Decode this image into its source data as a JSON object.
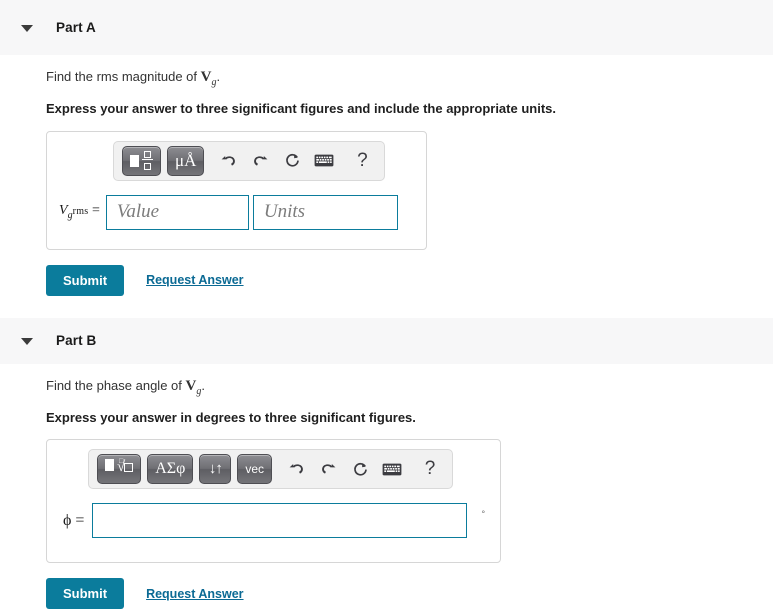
{
  "parts": [
    {
      "id": "part-a",
      "title": "Part A",
      "chevron_icon": "chevron-down-icon",
      "prompt_prefix": "Find the rms magnitude of ",
      "prompt_symbol": "V",
      "prompt_symbol_sub": "g",
      "prompt_suffix": ".",
      "instruction": "Express your answer to three significant figures and include the appropriate units.",
      "toolbar": [
        {
          "name": "template-button",
          "type": "template-squares",
          "label": ""
        },
        {
          "name": "units-button",
          "type": "text",
          "label": "μÅ"
        },
        {
          "name": "undo-icon",
          "type": "icon",
          "label": "undo-icon"
        },
        {
          "name": "redo-icon",
          "type": "icon",
          "label": "redo-icon"
        },
        {
          "name": "reset-icon",
          "type": "icon",
          "label": "reset-icon"
        },
        {
          "name": "keyboard-icon",
          "type": "icon",
          "label": "keyboard-icon"
        },
        {
          "name": "help-icon",
          "type": "text-icon",
          "label": "?"
        }
      ],
      "equation_label": {
        "symbol": "V",
        "subscript": "g",
        "qualifier": "rms",
        "equals": "="
      },
      "fields": [
        {
          "name": "value-input",
          "placeholder": "Value",
          "value": ""
        },
        {
          "name": "units-input",
          "placeholder": "Units",
          "value": ""
        }
      ],
      "unit_suffix": "",
      "submit_label": "Submit",
      "request_answer_label": "Request Answer"
    },
    {
      "id": "part-b",
      "title": "Part B",
      "chevron_icon": "chevron-down-icon",
      "prompt_prefix": "Find the phase angle of ",
      "prompt_symbol": "V",
      "prompt_symbol_sub": "g",
      "prompt_suffix": ".",
      "instruction": "Express your answer in degrees to three significant figures.",
      "toolbar": [
        {
          "name": "template-button",
          "type": "template-root",
          "label": ""
        },
        {
          "name": "greek-symbols-button",
          "type": "text",
          "label": "ΑΣφ"
        },
        {
          "name": "arrows-button",
          "type": "text",
          "label": "↓↑"
        },
        {
          "name": "vector-button",
          "type": "text",
          "label": "vec"
        },
        {
          "name": "undo-icon",
          "type": "icon",
          "label": "undo-icon"
        },
        {
          "name": "redo-icon",
          "type": "icon",
          "label": "redo-icon"
        },
        {
          "name": "reset-icon",
          "type": "icon",
          "label": "reset-icon"
        },
        {
          "name": "keyboard-icon",
          "type": "icon",
          "label": "keyboard-icon"
        },
        {
          "name": "help-icon",
          "type": "text-icon",
          "label": "?"
        }
      ],
      "equation_label": {
        "symbol": "ϕ",
        "equals": "="
      },
      "fields": [
        {
          "name": "phi-input",
          "placeholder": "",
          "value": ""
        }
      ],
      "unit_suffix": "°",
      "submit_label": "Submit",
      "request_answer_label": "Request Answer"
    }
  ],
  "colors": {
    "accent": "#0b7c9c",
    "link": "#0b6a94",
    "header_band": "#f7f7f8",
    "panel_border": "#d6d6d6"
  }
}
